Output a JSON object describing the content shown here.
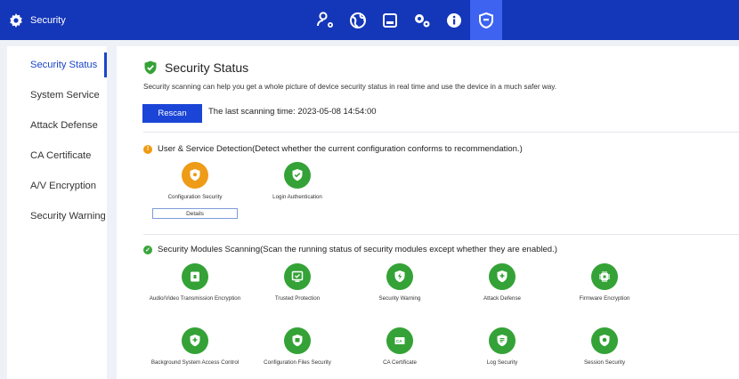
{
  "app": {
    "title": "Security"
  },
  "nav_icons": [
    "users-settings-icon",
    "network-globe-icon",
    "storage-icon",
    "system-gears-icon",
    "info-icon",
    "security-shield-icon"
  ],
  "sidebar": {
    "items": [
      {
        "label": "Security Status",
        "active": true
      },
      {
        "label": "System Service"
      },
      {
        "label": "Attack Defense"
      },
      {
        "label": "CA Certificate"
      },
      {
        "label": "A/V Encryption"
      },
      {
        "label": "Security Warning"
      }
    ]
  },
  "main": {
    "title": "Security Status",
    "description": "Security scanning can help you get a whole picture of device security status in real time and use the device in a much safer way.",
    "rescan_label": "Rescan",
    "last_scan": "The last scanning time: 2023-05-08 14:54:00",
    "user_service": {
      "heading": "User & Service Detection(Detect whether the current configuration conforms to recommendation.)",
      "items": [
        {
          "label": "Configuration Security",
          "status": "warning",
          "color": "#ee9b17"
        },
        {
          "label": "Login Authentication",
          "status": "ok",
          "color": "#34a236"
        }
      ],
      "details_label": "Details"
    },
    "modules": {
      "heading": "Security Modules Scanning(Scan the running status of security modules except whether they are enabled.)",
      "items": [
        {
          "label": "Audio/Video Transmission Encryption"
        },
        {
          "label": "Trusted Protection"
        },
        {
          "label": "Security Warning"
        },
        {
          "label": "Attack Defense"
        },
        {
          "label": "Firmware Encryption"
        },
        {
          "label": "Background System Access Control"
        },
        {
          "label": "Configuration Files Security"
        },
        {
          "label": "CA Certificate"
        },
        {
          "label": "Log Security"
        },
        {
          "label": "Session Security"
        }
      ]
    }
  },
  "colors": {
    "topbar": "#1436b8",
    "accent": "#1a45c8",
    "ok": "#34a236",
    "warn": "#ee9b17"
  }
}
